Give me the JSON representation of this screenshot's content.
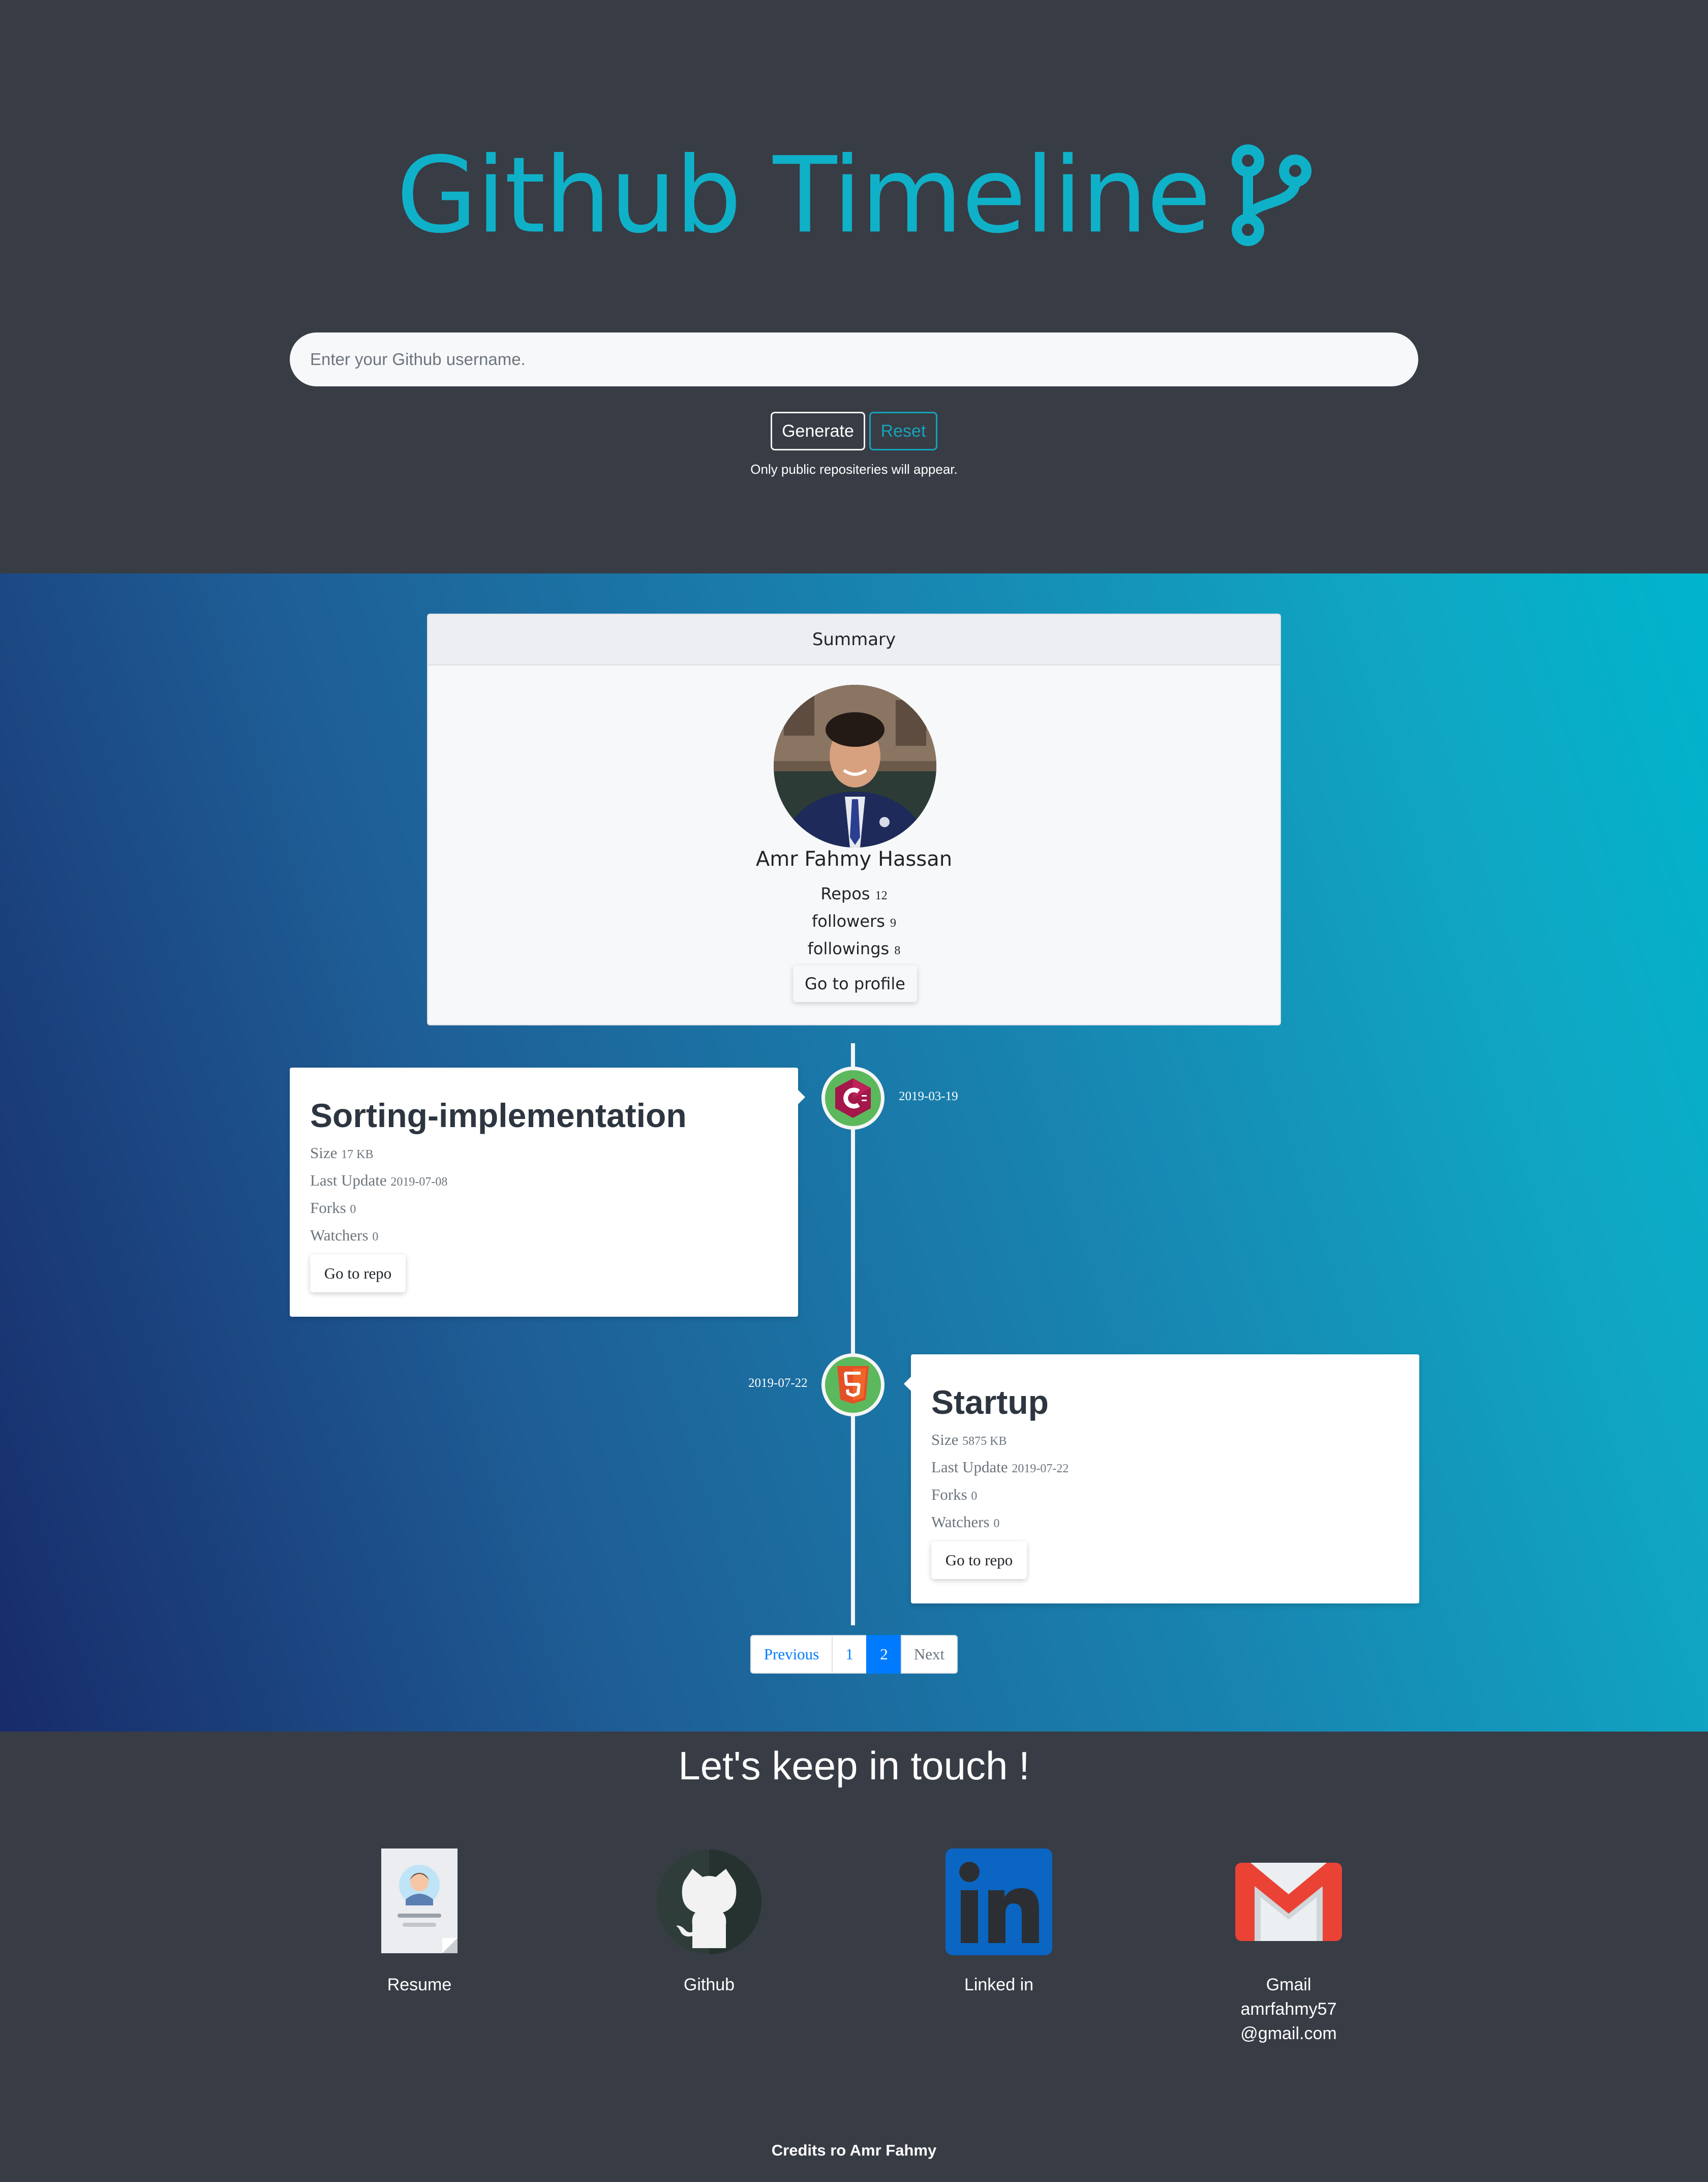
{
  "header": {
    "title": "Github Timeline",
    "search_placeholder": "Enter your Github username.",
    "generate_label": "Generate",
    "reset_label": "Reset",
    "note": "Only public repositeries will appear."
  },
  "summary": {
    "heading": "Summary",
    "name": "Amr Fahmy Hassan",
    "repos_label": "Repos",
    "repos_count": "12",
    "followers_label": "followers",
    "followers_count": "9",
    "followings_label": "followings",
    "followings_count": "8",
    "profile_button": "Go to profile"
  },
  "timeline": [
    {
      "name": "Sorting-implementation",
      "date": "2019-03-19",
      "language_icon": "cpp-icon",
      "size_label": "Size",
      "size": "17 KB",
      "update_label": "Last Update",
      "update": "2019-07-08",
      "forks_label": "Forks",
      "forks": "0",
      "watchers_label": "Watchers",
      "watchers": "0",
      "button": "Go to repo"
    },
    {
      "name": "Startup",
      "date": "2019-07-22",
      "language_icon": "html5-icon",
      "size_label": "Size",
      "size": "5875 KB",
      "update_label": "Last Update",
      "update": "2019-07-22",
      "forks_label": "Forks",
      "forks": "0",
      "watchers_label": "Watchers",
      "watchers": "0",
      "button": "Go to repo"
    }
  ],
  "pagination": {
    "previous": "Previous",
    "pages": [
      "1",
      "2"
    ],
    "active_page": "2",
    "next": "Next"
  },
  "footer": {
    "title": "Let's keep in touch !",
    "contacts": [
      {
        "label": "Resume",
        "icon": "resume-icon"
      },
      {
        "label": "Github",
        "icon": "github-icon"
      },
      {
        "label": "Linked in",
        "icon": "linkedin-icon"
      },
      {
        "label": "Gmail\namrfahmy57\n@gmail.com",
        "icon": "gmail-icon"
      }
    ],
    "credits": "Credits ro Amr Fahmy"
  },
  "colors": {
    "accent": "#0fb1c8",
    "header_bg": "#383c45",
    "gradient_start": "#182b6a",
    "gradient_end": "#00b5cc",
    "node_green": "#5cb85c",
    "pagination_active": "#007bff"
  }
}
